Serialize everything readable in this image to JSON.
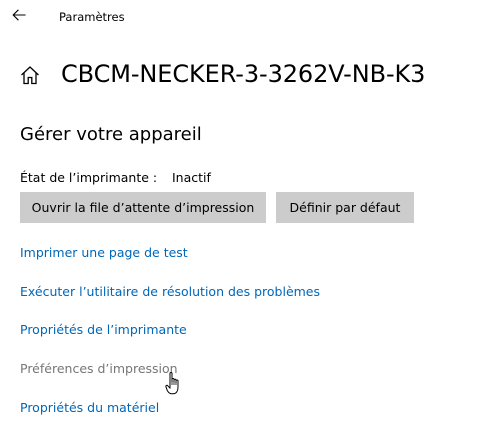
{
  "window": {
    "title": "Paramètres"
  },
  "header": {
    "title": "CBCM-NECKER-3-3262V-NB-K3"
  },
  "section": {
    "title": "Gérer votre appareil"
  },
  "status": {
    "label": "État de l’imprimante :",
    "value": "Inactif"
  },
  "buttons": {
    "open_queue": "Ouvrir la file d’attente d’impression",
    "set_default": "Définir par défaut"
  },
  "links": [
    "Imprimer une page de test",
    "Exécuter l’utilitaire de résolution des problèmes",
    "Propriétés de l’imprimante",
    "Préférences d’impression",
    "Propriétés du matériel"
  ],
  "colors": {
    "link": "#0067b8",
    "link_hover": "#767676",
    "button_bg": "#cccccc",
    "background": "#ffffff"
  },
  "icons": {
    "back": "arrow-left-icon",
    "home": "home-icon",
    "cursor": "hand-pointer-cursor"
  }
}
